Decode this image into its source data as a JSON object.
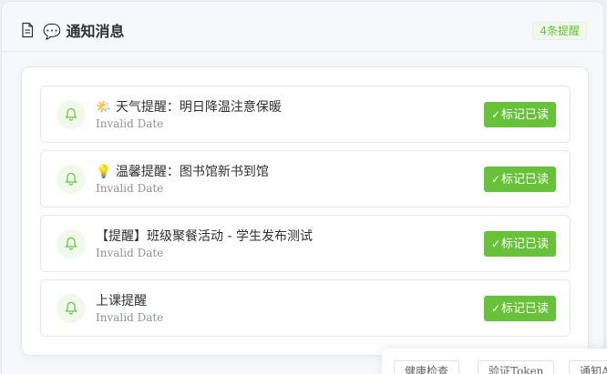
{
  "header": {
    "icon": "document-icon",
    "title": "💬 通知消息",
    "badge": "4条提醒"
  },
  "notifications": [
    {
      "icon": "bell-icon",
      "title": "🌤️ 天气提醒：明日降温注意保暖",
      "date": "Invalid Date",
      "action": "标记已读"
    },
    {
      "icon": "bell-icon",
      "title": "💡 温馨提醒：图书馆新书到馆",
      "date": "Invalid Date",
      "action": "标记已读"
    },
    {
      "icon": "bell-icon",
      "title": "【提醒】班级聚餐活动 - 学生发布测试",
      "date": "Invalid Date",
      "action": "标记已读"
    },
    {
      "icon": "bell-icon",
      "title": "上课提醒",
      "date": "Invalid Date",
      "action": "标记已读"
    }
  ],
  "toolbar": {
    "health_check": "健康检查",
    "verify_token": "验证Token",
    "notify": "通知A"
  },
  "colors": {
    "accent": "#67c23a",
    "badge_bg": "#f0f9eb"
  }
}
